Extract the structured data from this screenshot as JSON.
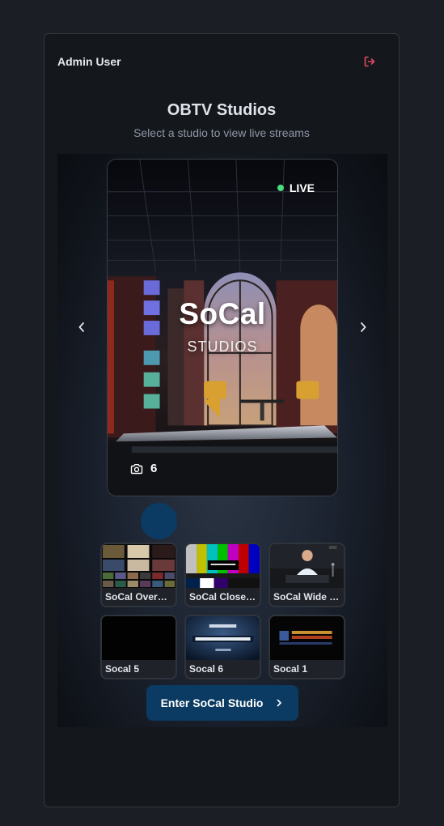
{
  "header": {
    "user_name": "Admin User",
    "logout_icon": "logout-icon",
    "logout_color": "#e04a5f"
  },
  "page": {
    "title": "OBTV Studios",
    "subtitle": "Select a studio to view live streams"
  },
  "featured_studio": {
    "status": "LIVE",
    "status_color": "#4ade80",
    "name_main": "SoCal",
    "name_sub": "STUDIOS",
    "camera_count": "6",
    "camera_icon": "camera-icon"
  },
  "carousel": {
    "prev_icon": "chevron-left-icon",
    "next_icon": "chevron-right-icon",
    "active_indicator_color": "#0b3a63"
  },
  "cameras": [
    {
      "label": "SoCal Overhead"
    },
    {
      "label": "SoCal Close Up"
    },
    {
      "label": "SoCal Wide Shot"
    },
    {
      "label": "Socal 5"
    },
    {
      "label": "Socal 6"
    },
    {
      "label": "Socal 1"
    }
  ],
  "actions": {
    "enter_label": "Enter SoCal Studio",
    "enter_icon": "chevron-right-icon",
    "accent_color": "#0b3b62"
  }
}
